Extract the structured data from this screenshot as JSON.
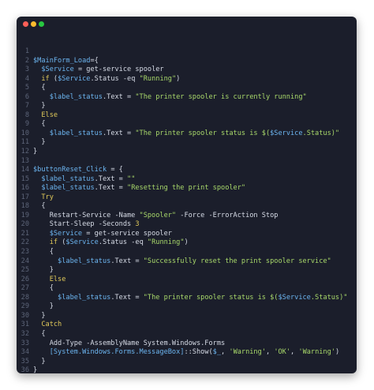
{
  "window": {
    "controls": [
      {
        "name": "close",
        "color": "#ff5f57"
      },
      {
        "name": "minimize",
        "color": "#febc2e"
      },
      {
        "name": "maximize",
        "color": "#28c840"
      }
    ]
  },
  "colors": {
    "background": "#1b1e2b",
    "keyword": "#e0c95a",
    "variable": "#6cb5f0",
    "string": "#a8d86a",
    "plain": "#d6dbe6",
    "line_number": "#5c6478"
  },
  "code_lines": [
    {
      "n": "1",
      "tokens": []
    },
    {
      "n": "2",
      "tokens": [
        {
          "t": "$MainForm_Load",
          "c": "var"
        },
        {
          "t": "={",
          "c": "plain"
        }
      ]
    },
    {
      "n": "3",
      "tokens": [
        {
          "t": "  ",
          "c": "plain"
        },
        {
          "t": "$Service",
          "c": "var"
        },
        {
          "t": " = get-service spooler",
          "c": "plain"
        }
      ]
    },
    {
      "n": "4",
      "tokens": [
        {
          "t": "  ",
          "c": "plain"
        },
        {
          "t": "if",
          "c": "kw"
        },
        {
          "t": " (",
          "c": "plain"
        },
        {
          "t": "$Service",
          "c": "var"
        },
        {
          "t": ".Status -eq ",
          "c": "plain"
        },
        {
          "t": "\"Running\"",
          "c": "str"
        },
        {
          "t": ")",
          "c": "plain"
        }
      ]
    },
    {
      "n": "5",
      "tokens": [
        {
          "t": "  {",
          "c": "plain"
        }
      ]
    },
    {
      "n": "6",
      "tokens": [
        {
          "t": "    ",
          "c": "plain"
        },
        {
          "t": "$label_status",
          "c": "var"
        },
        {
          "t": ".Text = ",
          "c": "plain"
        },
        {
          "t": "\"The printer spooler is currently running\"",
          "c": "str"
        }
      ]
    },
    {
      "n": "7",
      "tokens": [
        {
          "t": "  }",
          "c": "plain"
        }
      ]
    },
    {
      "n": "8",
      "tokens": [
        {
          "t": "  ",
          "c": "plain"
        },
        {
          "t": "Else",
          "c": "kw"
        }
      ]
    },
    {
      "n": "9",
      "tokens": [
        {
          "t": "  {",
          "c": "plain"
        }
      ]
    },
    {
      "n": "10",
      "tokens": [
        {
          "t": "    ",
          "c": "plain"
        },
        {
          "t": "$label_status",
          "c": "var"
        },
        {
          "t": ".Text = ",
          "c": "plain"
        },
        {
          "t": "\"The printer spooler status is $(",
          "c": "str"
        },
        {
          "t": "$Service",
          "c": "var"
        },
        {
          "t": ".Status)\"",
          "c": "str"
        }
      ]
    },
    {
      "n": "11",
      "tokens": [
        {
          "t": "  }",
          "c": "plain"
        }
      ]
    },
    {
      "n": "12",
      "tokens": [
        {
          "t": "}",
          "c": "plain"
        }
      ]
    },
    {
      "n": "13",
      "tokens": []
    },
    {
      "n": "14",
      "tokens": [
        {
          "t": "$buttonReset_Click",
          "c": "var"
        },
        {
          "t": " = {",
          "c": "plain"
        }
      ]
    },
    {
      "n": "15",
      "tokens": [
        {
          "t": "  ",
          "c": "plain"
        },
        {
          "t": "$label_status",
          "c": "var"
        },
        {
          "t": ".Text = ",
          "c": "plain"
        },
        {
          "t": "\"\"",
          "c": "str"
        }
      ]
    },
    {
      "n": "16",
      "tokens": [
        {
          "t": "  ",
          "c": "plain"
        },
        {
          "t": "$label_status",
          "c": "var"
        },
        {
          "t": ".Text = ",
          "c": "plain"
        },
        {
          "t": "\"Resetting the print spooler\"",
          "c": "str"
        }
      ]
    },
    {
      "n": "17",
      "tokens": [
        {
          "t": "  ",
          "c": "plain"
        },
        {
          "t": "Try",
          "c": "kw"
        }
      ]
    },
    {
      "n": "18",
      "tokens": [
        {
          "t": "  {",
          "c": "plain"
        }
      ]
    },
    {
      "n": "19",
      "tokens": [
        {
          "t": "    Restart-Service -Name ",
          "c": "plain"
        },
        {
          "t": "\"Spooler\"",
          "c": "str"
        },
        {
          "t": " -Force -ErrorAction Stop",
          "c": "plain"
        }
      ]
    },
    {
      "n": "20",
      "tokens": [
        {
          "t": "    Start-Sleep -Seconds ",
          "c": "plain"
        },
        {
          "t": "3",
          "c": "num"
        }
      ]
    },
    {
      "n": "21",
      "tokens": [
        {
          "t": "    ",
          "c": "plain"
        },
        {
          "t": "$Service",
          "c": "var"
        },
        {
          "t": " = get-service spooler",
          "c": "plain"
        }
      ]
    },
    {
      "n": "22",
      "tokens": [
        {
          "t": "    ",
          "c": "plain"
        },
        {
          "t": "if",
          "c": "kw"
        },
        {
          "t": " (",
          "c": "plain"
        },
        {
          "t": "$Service",
          "c": "var"
        },
        {
          "t": ".Status -eq ",
          "c": "plain"
        },
        {
          "t": "\"Running\"",
          "c": "str"
        },
        {
          "t": ")",
          "c": "plain"
        }
      ]
    },
    {
      "n": "23",
      "tokens": [
        {
          "t": "    {",
          "c": "plain"
        }
      ]
    },
    {
      "n": "24",
      "tokens": [
        {
          "t": "      ",
          "c": "plain"
        },
        {
          "t": "$label_status",
          "c": "var"
        },
        {
          "t": ".Text = ",
          "c": "plain"
        },
        {
          "t": "\"Successfully reset the print spooler service\"",
          "c": "str"
        }
      ]
    },
    {
      "n": "25",
      "tokens": [
        {
          "t": "    }",
          "c": "plain"
        }
      ]
    },
    {
      "n": "26",
      "tokens": [
        {
          "t": "    ",
          "c": "plain"
        },
        {
          "t": "Else",
          "c": "kw"
        }
      ]
    },
    {
      "n": "27",
      "tokens": [
        {
          "t": "    {",
          "c": "plain"
        }
      ]
    },
    {
      "n": "28",
      "tokens": [
        {
          "t": "      ",
          "c": "plain"
        },
        {
          "t": "$label_status",
          "c": "var"
        },
        {
          "t": ".Text = ",
          "c": "plain"
        },
        {
          "t": "\"The printer spooler status is $(",
          "c": "str"
        },
        {
          "t": "$Service",
          "c": "var"
        },
        {
          "t": ".Status)\"",
          "c": "str"
        }
      ]
    },
    {
      "n": "29",
      "tokens": [
        {
          "t": "    }",
          "c": "plain"
        }
      ]
    },
    {
      "n": "30",
      "tokens": [
        {
          "t": "  }",
          "c": "plain"
        }
      ]
    },
    {
      "n": "31",
      "tokens": [
        {
          "t": "  ",
          "c": "plain"
        },
        {
          "t": "Catch",
          "c": "kw"
        }
      ]
    },
    {
      "n": "32",
      "tokens": [
        {
          "t": "  {",
          "c": "plain"
        }
      ]
    },
    {
      "n": "33",
      "tokens": [
        {
          "t": "    Add-Type -AssemblyName System.Windows.Forms",
          "c": "plain"
        }
      ]
    },
    {
      "n": "34",
      "tokens": [
        {
          "t": "    ",
          "c": "plain"
        },
        {
          "t": "[System.Windows.Forms.MessageBox]",
          "c": "var"
        },
        {
          "t": "::Show(",
          "c": "plain"
        },
        {
          "t": "$_",
          "c": "var"
        },
        {
          "t": ", ",
          "c": "plain"
        },
        {
          "t": "'Warning'",
          "c": "str"
        },
        {
          "t": ", ",
          "c": "plain"
        },
        {
          "t": "'OK'",
          "c": "str"
        },
        {
          "t": ", ",
          "c": "plain"
        },
        {
          "t": "'Warning'",
          "c": "str"
        },
        {
          "t": ")",
          "c": "plain"
        }
      ]
    },
    {
      "n": "35",
      "tokens": [
        {
          "t": "  }",
          "c": "plain"
        }
      ]
    },
    {
      "n": "36",
      "tokens": [
        {
          "t": "}",
          "c": "plain"
        }
      ]
    },
    {
      "n": "37",
      "tokens": []
    }
  ]
}
